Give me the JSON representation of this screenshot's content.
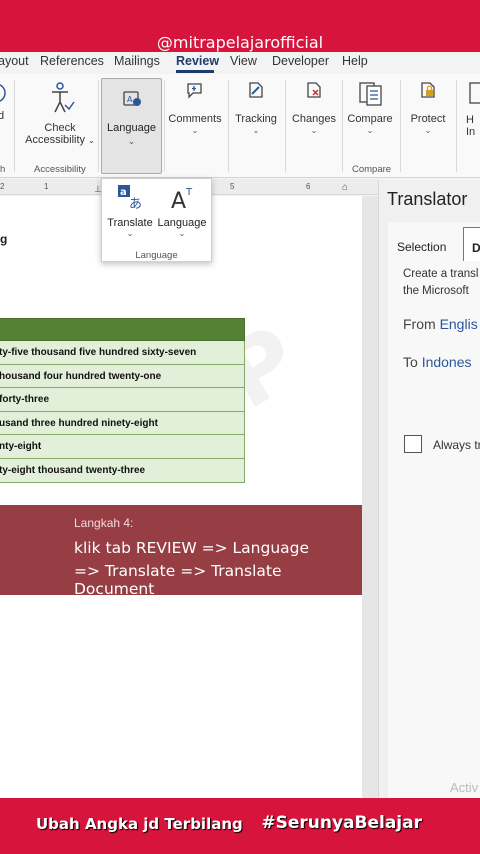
{
  "overlay": {
    "handle": "@mitrapelajarofficial",
    "bottom_left": "Ubah Angka jd Terbilang",
    "bottom_right": "#SerunyaBelajar"
  },
  "menu_tabs": [
    "ayout",
    "References",
    "Mailings",
    "Review",
    "View",
    "Developer",
    "Help"
  ],
  "active_tab": "Review",
  "ribbon": {
    "buttons": {
      "partial_left": "d",
      "check_accessibility_line1": "Check",
      "check_accessibility_line2": "Accessibility",
      "language": "Language",
      "comments": "Comments",
      "tracking": "Tracking",
      "changes": "Changes",
      "compare": "Compare",
      "protect": "Protect",
      "partial_right_1": "H",
      "partial_right_2": "In"
    },
    "groups": {
      "left_partial": "h",
      "accessibility": "Accessibility",
      "compare": "Compare"
    }
  },
  "ruler": [
    "2",
    "1",
    "5",
    "6"
  ],
  "language_popup": {
    "translate": "Translate",
    "language": "Language",
    "group_label": "Language"
  },
  "document": {
    "heading": "g",
    "table_rows": [
      "ty-five thousand five hundred sixty-seven",
      "housand four hundred twenty-one",
      " forty-three",
      "usand three hundred ninety-eight",
      "nty-eight",
      "ty-eight thousand twenty-three"
    ]
  },
  "caption": {
    "step": "Langkah 4:",
    "line1": "klik tab REVIEW => Language",
    "line2": "=> Translate => Translate Document"
  },
  "translator": {
    "title": "Translator",
    "tab_selection": "Selection",
    "tab_document": "D",
    "desc_line1": "Create a transl",
    "desc_line2": "the Microsoft",
    "from_label": "From",
    "from_value": "Englis",
    "to_label": "To",
    "to_value": "Indones",
    "always_label": "Always tr",
    "activate": "Activ"
  },
  "colors": {
    "brand_red": "#d6143c",
    "table_header": "#548235",
    "table_row": "#e2efd9",
    "caption_bg": "#973e44",
    "accent_blue": "#2b579a"
  }
}
